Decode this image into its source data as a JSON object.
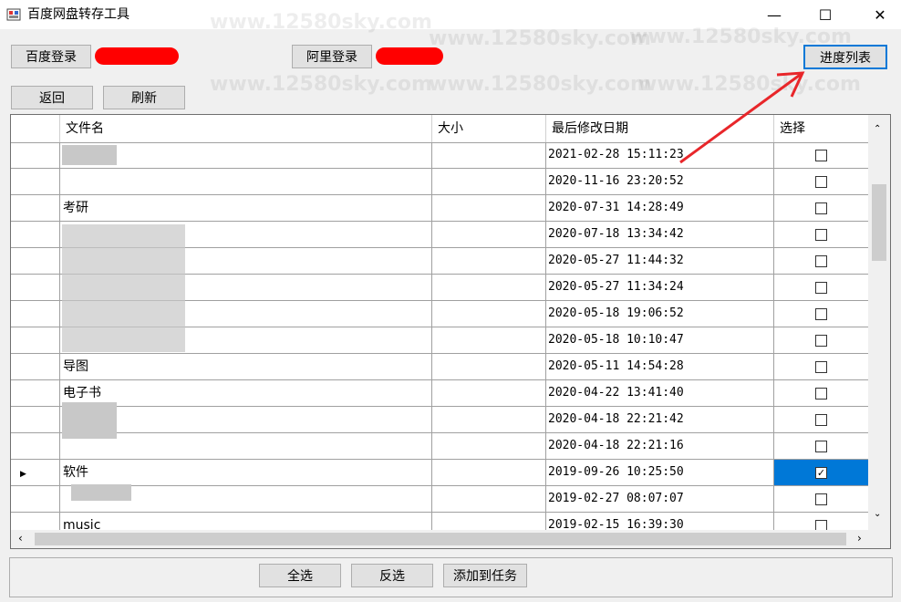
{
  "window": {
    "title": "百度网盘转存工具",
    "controls": {
      "minimize": "—",
      "maximize": "☐",
      "close": "✕"
    }
  },
  "toolbar": {
    "baidu_login": "百度登录",
    "ali_login": "阿里登录",
    "progress_list": "进度列表",
    "back": "返回",
    "refresh": "刷新"
  },
  "grid": {
    "columns": [
      "文件名",
      "大小",
      "最后修改日期",
      "选择"
    ],
    "current_row_marker": "▶",
    "rows": [
      {
        "name": "",
        "size": "",
        "date": "2021-02-28 15:11:23",
        "selected": false
      },
      {
        "name": "",
        "size": "",
        "date": "2020-11-16 23:20:52",
        "selected": false
      },
      {
        "name": "考研",
        "size": "",
        "date": "2020-07-31 14:28:49",
        "selected": false
      },
      {
        "name": "",
        "size": "",
        "date": "2020-07-18 13:34:42",
        "selected": false
      },
      {
        "name": "",
        "size": "",
        "date": "2020-05-27 11:44:32",
        "selected": false
      },
      {
        "name": "",
        "size": "",
        "date": "2020-05-27 11:34:24",
        "selected": false
      },
      {
        "name": "",
        "size": "",
        "date": "2020-05-18 19:06:52",
        "selected": false
      },
      {
        "name": "",
        "size": "",
        "date": "2020-05-18 10:10:47",
        "selected": false
      },
      {
        "name": "导图",
        "size": "",
        "date": "2020-05-11 14:54:28",
        "selected": false
      },
      {
        "name": "电子书",
        "size": "",
        "date": "2020-04-22 13:41:40",
        "selected": false
      },
      {
        "name": "",
        "size": "",
        "date": "2020-04-18 22:21:42",
        "selected": false
      },
      {
        "name": "",
        "size": "",
        "date": "2020-04-18 22:21:16",
        "selected": false
      },
      {
        "name": "软件",
        "size": "",
        "date": "2019-09-26 10:25:50",
        "selected": true
      },
      {
        "name": "",
        "size": "",
        "date": "2019-02-27 08:07:07",
        "selected": false
      },
      {
        "name": "music",
        "size": "",
        "date": "2019-02-15 16:39:30",
        "selected": false
      }
    ]
  },
  "bottom": {
    "select_all": "全选",
    "invert": "反选",
    "add_task": "添加到任务"
  },
  "watermark": "www.12580sky.com",
  "colors": {
    "selection": "#0078d7",
    "redaction": "#ff0000",
    "arrow": "#e8262a"
  }
}
